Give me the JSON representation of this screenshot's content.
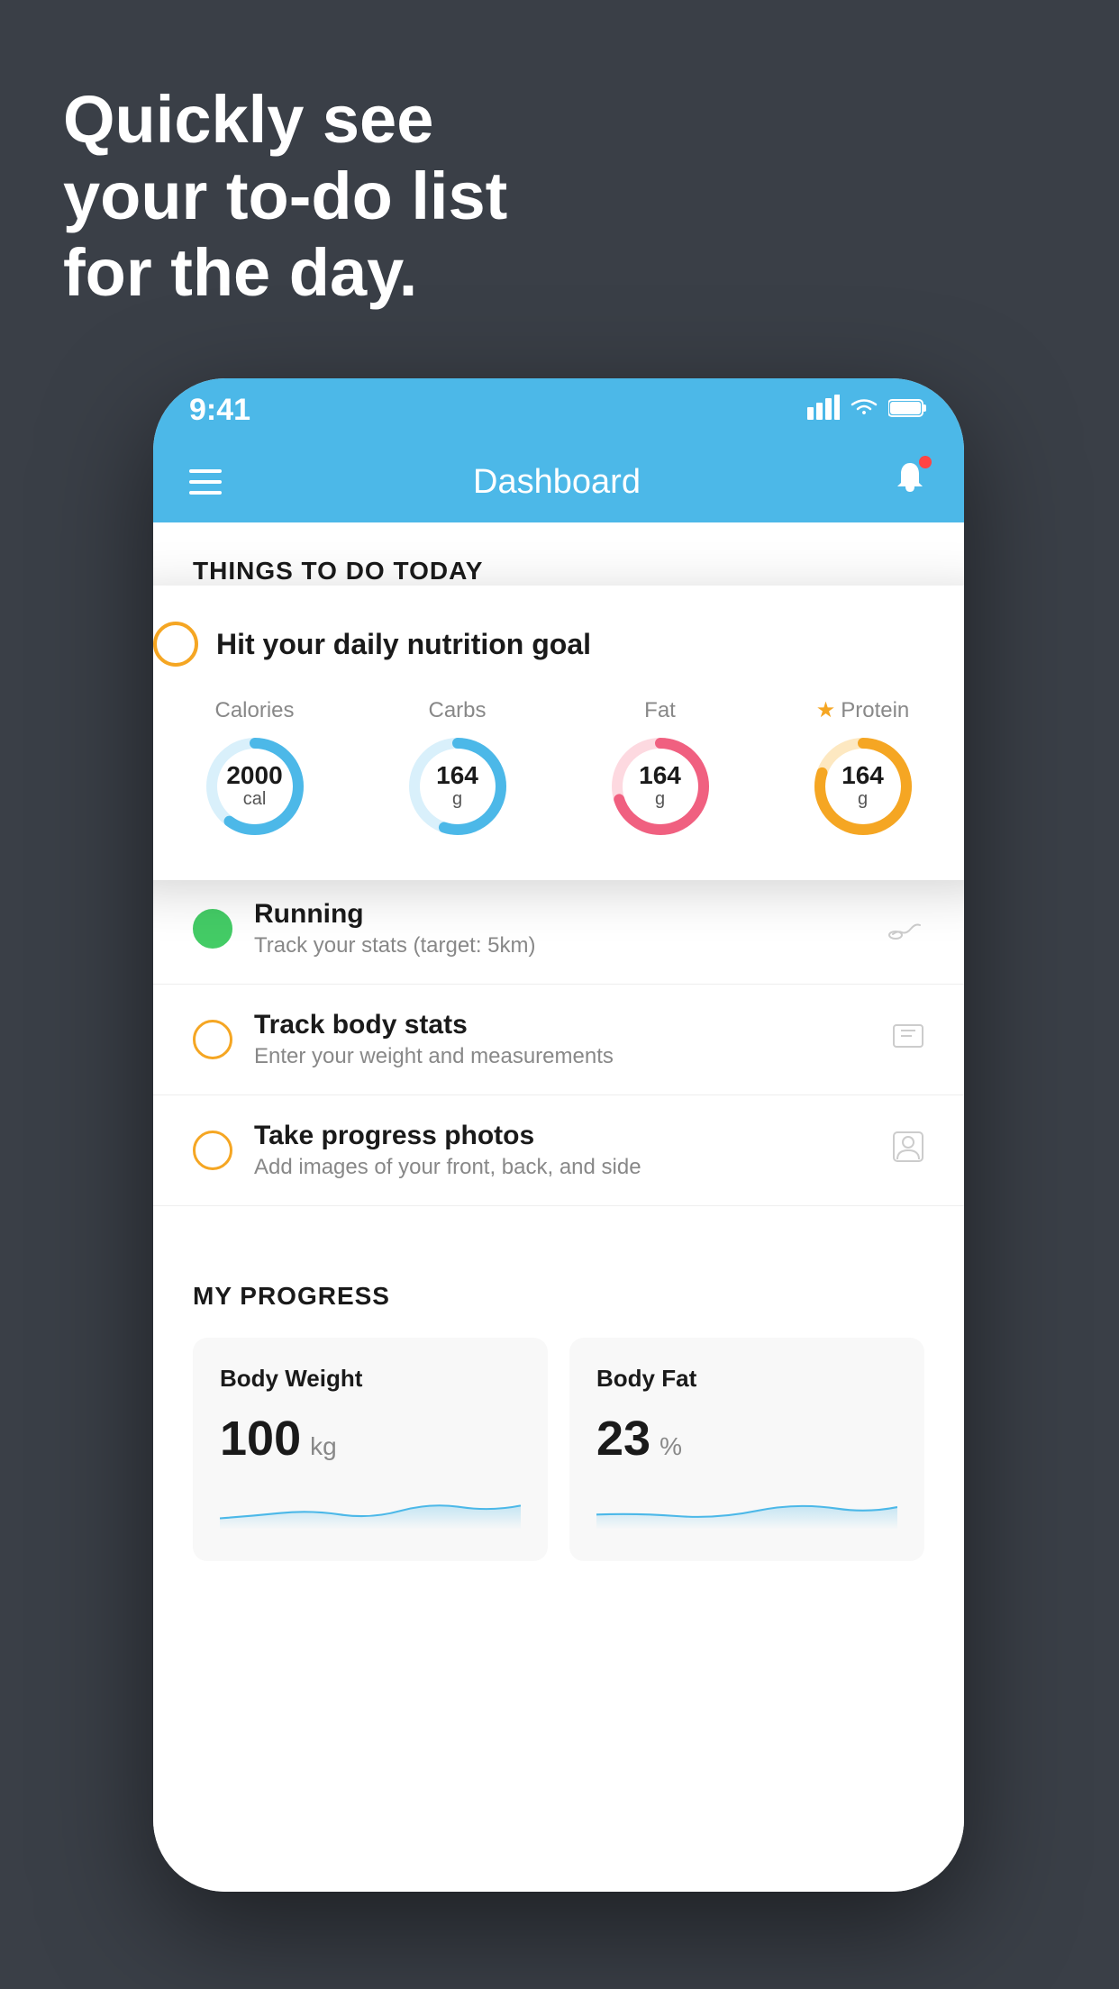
{
  "background_color": "#3a3f47",
  "hero": {
    "line1": "Quickly see",
    "line2": "your to-do list",
    "line3": "for the day."
  },
  "phone": {
    "status_bar": {
      "time": "9:41",
      "signal_icon": "▋▋▋▋",
      "wifi_icon": "WiFi",
      "battery_icon": "🔋"
    },
    "nav_bar": {
      "title": "Dashboard",
      "menu_label": "Menu",
      "bell_label": "Notifications"
    },
    "things_to_do": {
      "section_title": "THINGS TO DO TODAY",
      "floating_card": {
        "title": "Hit your daily nutrition goal",
        "items": [
          {
            "label": "Calories",
            "value": "2000",
            "unit": "cal",
            "color": "#4cb8e8",
            "track_color": "#d9f0fb",
            "percent": 60
          },
          {
            "label": "Carbs",
            "value": "164",
            "unit": "g",
            "color": "#4cb8e8",
            "track_color": "#d9f0fb",
            "percent": 55
          },
          {
            "label": "Fat",
            "value": "164",
            "unit": "g",
            "color": "#f06080",
            "track_color": "#fdd9e0",
            "percent": 70
          },
          {
            "label": "Protein",
            "value": "164",
            "unit": "g",
            "color": "#f5a623",
            "track_color": "#fde8c1",
            "percent": 80,
            "starred": true
          }
        ]
      },
      "todo_items": [
        {
          "id": "running",
          "title": "Running",
          "subtitle": "Track your stats (target: 5km)",
          "completed": true,
          "icon": "shoe"
        },
        {
          "id": "track-body-stats",
          "title": "Track body stats",
          "subtitle": "Enter your weight and measurements",
          "completed": false,
          "icon": "scale"
        },
        {
          "id": "progress-photos",
          "title": "Take progress photos",
          "subtitle": "Add images of your front, back, and side",
          "completed": false,
          "icon": "person"
        }
      ]
    },
    "my_progress": {
      "section_title": "MY PROGRESS",
      "cards": [
        {
          "title": "Body Weight",
          "value": "100",
          "unit": "kg"
        },
        {
          "title": "Body Fat",
          "value": "23",
          "unit": "%"
        }
      ]
    }
  }
}
